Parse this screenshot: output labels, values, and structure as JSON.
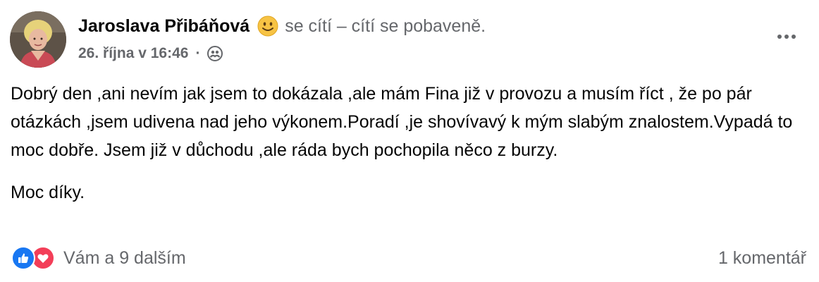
{
  "post": {
    "author": "Jaroslava Přibáňová",
    "feeling": "se cítí – cítí se pobaveně.",
    "timestamp": "26. října v 16:46",
    "separator": "·",
    "body_paragraphs": [
      "Dobrý den ,ani nevím jak jsem to dokázala ,ale mám Fina již v provozu a musím říct , že po pár otázkách ,jsem udivena nad jeho výkonem.Poradí ,je shovívavý k mým slabým znalostem.Vypadá to moc dobře. Jsem již v důchodu ,ale ráda bych pochopila něco z burzy.",
      "Moc díky."
    ],
    "reactions_text": "Vám a 9 dalším",
    "comments_text": "1 komentář",
    "icons": {
      "feeling": "smiling-face-icon",
      "privacy": "friends-icon",
      "more": "more-dots-icon",
      "like": "like-reaction-icon",
      "love": "love-reaction-icon"
    }
  },
  "colors": {
    "primary_text": "#050505",
    "secondary_text": "#65676b",
    "like_blue": "#1877f2",
    "love_red": "#f33e58",
    "emoji_yellow": "#f7c344"
  }
}
